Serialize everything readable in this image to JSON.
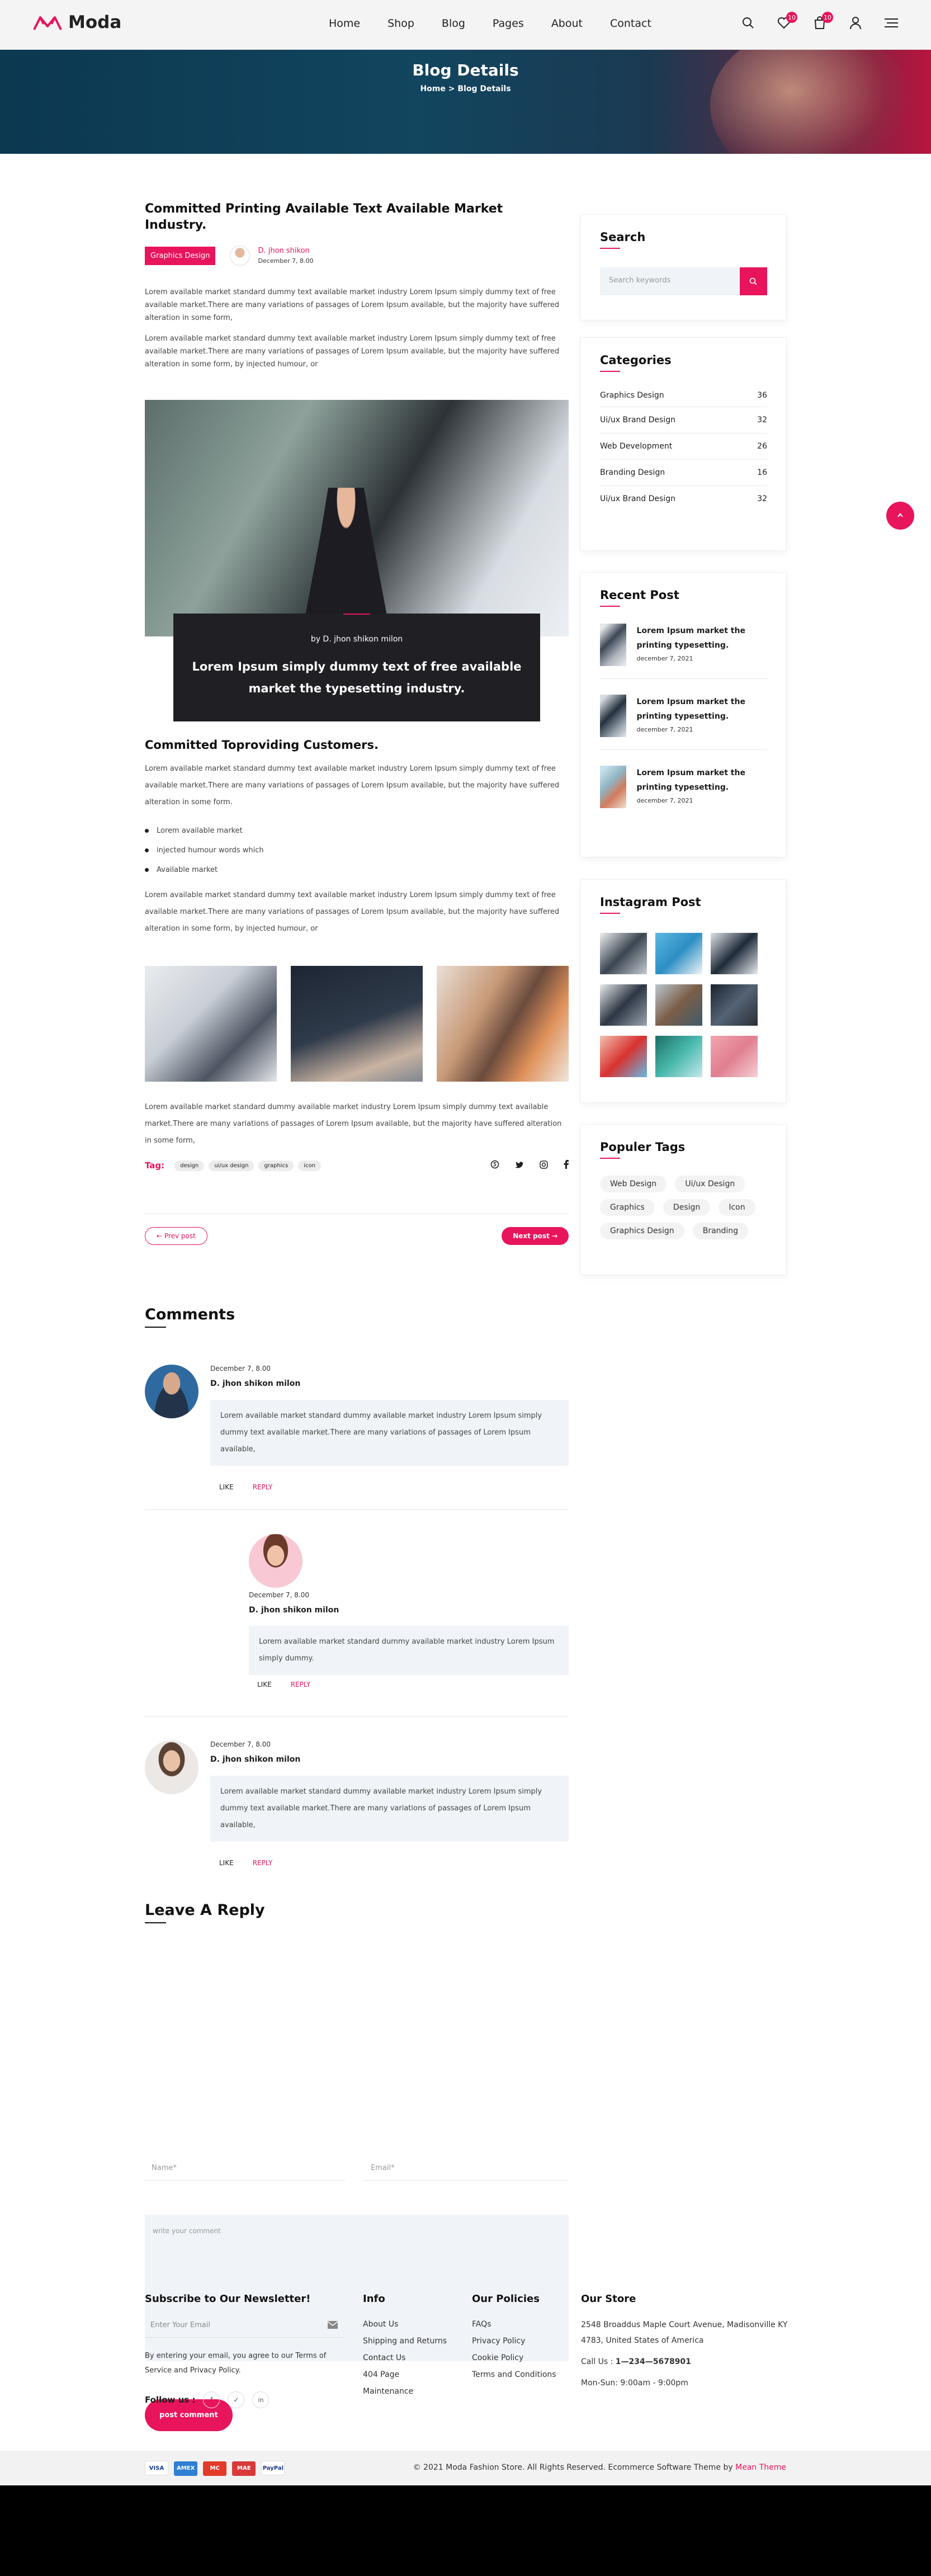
{
  "header": {
    "brand": "Moda",
    "nav": [
      "Home",
      "Shop",
      "Blog",
      "Pages",
      "About",
      "Contact"
    ],
    "wishlist_count": "10",
    "cart_count": "10"
  },
  "hero": {
    "title": "Blog Details",
    "crumb_home": "Home",
    "crumb_sep": ">",
    "crumb_current": "Blog Details"
  },
  "post": {
    "title": "Committed Printing Available Text Available Market Industry.",
    "category": "Graphics Design",
    "author": "D. jhon shikon",
    "date": "December 7, 8.00",
    "para1": "Lorem available market standard dummy text available market industry Lorem Ipsum simply dummy text of free available market.There are many variations of passages of Lorem Ipsum available, but the majority have suffered alteration in some form,",
    "para2": "Lorem available market standard dummy text available market industry Lorem Ipsum simply dummy text of free available market.There are many variations of passages of Lorem Ipsum available, but the majority have suffered alteration in some form, by injected humour, or",
    "quote_by": "by D. jhon shikon milon",
    "quote": "Lorem Ipsum simply dummy text of free available market the typesetting industry.",
    "sub_title": "Committed Toproviding Customers.",
    "para3": "Lorem available market standard dummy text available market industry Lorem Ipsum simply dummy text of free available market.There are many variations of passages of Lorem Ipsum available, but the majority have suffered alteration in some form.",
    "bullets": [
      "Lorem available market",
      "injected humour words which",
      "Available market"
    ],
    "para4": "Lorem available market standard dummy text available market industry Lorem Ipsum simply dummy text of free available market.There are many variations of passages of Lorem Ipsum available, but the majority have suffered alteration in some form, by injected humour, or",
    "para5": "Lorem available market standard dummy available market industry Lorem Ipsum simply dummy text available market.There are many variations of passages of Lorem Ipsum available, but the majority have suffered alteration in some form,",
    "tag_label": "Tag:",
    "tags": [
      "design",
      "ui/ux design",
      "graphics",
      "icon"
    ],
    "prev": "← Prev post",
    "next": "Next post →"
  },
  "comments": {
    "title": "Comments",
    "items": [
      {
        "date": "December 7, 8.00",
        "name": "D. jhon shikon milon",
        "text": "Lorem available market standard dummy available market industry Lorem Ipsum simply dummy text available market.There are many variations of passages of Lorem Ipsum available,",
        "like": "LIKE",
        "reply": "REPLY"
      },
      {
        "date": "December 7, 8.00",
        "name": "D. jhon shikon milon",
        "text": "Lorem available market standard dummy available market industry Lorem Ipsum simply dummy.",
        "like": "LIKE",
        "reply": "REPLY"
      },
      {
        "date": "December 7, 8.00",
        "name": "D. jhon shikon milon",
        "text": "Lorem available market standard dummy available market industry Lorem Ipsum simply dummy text available market.There are many variations of passages of Lorem Ipsum available,",
        "like": "LIKE",
        "reply": "REPLY"
      }
    ]
  },
  "reply": {
    "title": "Leave A Reply",
    "name_ph": "Name*",
    "email_ph": "Email*",
    "comment_ph": "write your comment",
    "submit": "post comment"
  },
  "sidebar": {
    "search_title": "Search",
    "search_ph": "Search keywords",
    "cat_title": "Categories",
    "categories": [
      {
        "name": "Graphics Design",
        "count": "36"
      },
      {
        "name": "Ui/ux Brand Design",
        "count": "32"
      },
      {
        "name": "Web Development",
        "count": "26"
      },
      {
        "name": "Branding Design",
        "count": "16"
      },
      {
        "name": "Ui/ux Brand Design",
        "count": "32"
      }
    ],
    "recent_title": "Recent Post",
    "recent": [
      {
        "title": "Lorem Ipsum market the printing typesetting.",
        "date": "december 7, 2021"
      },
      {
        "title": "Lorem Ipsum market the printing typesetting.",
        "date": "december 7, 2021"
      },
      {
        "title": "Lorem Ipsum market the printing typesetting.",
        "date": "december 7, 2021"
      }
    ],
    "insta_title": "Instagram Post",
    "tags_title": "Populer Tags",
    "tags": [
      "Web Design",
      "Ui/ux Design",
      "Graphics",
      "Design",
      "Icon",
      "Graphics Design",
      "Branding"
    ]
  },
  "footer": {
    "news_title": "Subscribe to Our Newsletter!",
    "email_ph": "Enter Your Email",
    "news_note": "By entering your email, you agree to our Terms of Service and Privacy Policy.",
    "follow": "Follow us :",
    "info_title": "Info",
    "info": [
      "About Us",
      "Shipping and Returns",
      "Contact Us",
      "404 Page",
      "Maintenance"
    ],
    "policy_title": "Our Policies",
    "policies": [
      "FAQs",
      "Privacy Policy",
      "Cookie Policy",
      "Terms and Conditions"
    ],
    "store_title": "Our Store",
    "address": "2548 Broaddus Maple Court Avenue, Madisonville KY 4783, United States of America",
    "call_label": "Call Us :",
    "phone": "1—234—5678901",
    "hours": "Mon-Sun: 9:00am - 9:00pm",
    "copyright": "© 2021 Moda Fashion Store. All Rights Reserved. Ecommerce Software Theme by",
    "credit": "Mean Theme",
    "payments": [
      "VISA",
      "AMEX",
      "MC",
      "MAE",
      "PayPal"
    ]
  },
  "colors": {
    "accent": "#e8155c",
    "dark": "#111111"
  }
}
